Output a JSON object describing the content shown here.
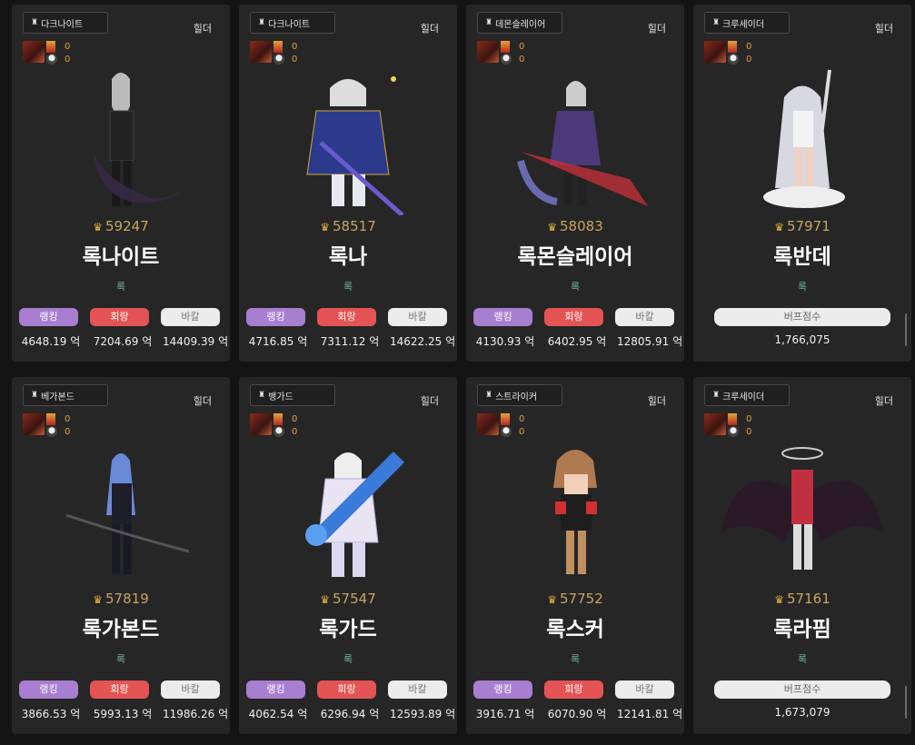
{
  "cards": [
    {
      "class": "다크나이트",
      "server": "힐더",
      "count1": "0",
      "count2": "0",
      "score": "59247",
      "name": "록나이트",
      "guild": "록",
      "type": "dealer",
      "rank_label": "랭킹",
      "corr_label": "회랑",
      "bakal_label": "바칼",
      "rank": "4648.19 억",
      "corr": "7204.69 억",
      "bakal": "14409.39 억"
    },
    {
      "class": "다크나이트",
      "server": "힐더",
      "count1": "0",
      "count2": "0",
      "score": "58517",
      "name": "록나",
      "guild": "록",
      "type": "dealer",
      "rank_label": "랭킹",
      "corr_label": "회랑",
      "bakal_label": "바칼",
      "rank": "4716.85 억",
      "corr": "7311.12 억",
      "bakal": "14622.25 억"
    },
    {
      "class": "데몬슬레이어",
      "server": "힐더",
      "count1": "0",
      "count2": "0",
      "score": "58083",
      "name": "록몬슬레이어",
      "guild": "록",
      "type": "dealer",
      "rank_label": "랭킹",
      "corr_label": "회랑",
      "bakal_label": "바칼",
      "rank": "4130.93 억",
      "corr": "6402.95 억",
      "bakal": "12805.91 억"
    },
    {
      "class": "크루세이더",
      "server": "힐더",
      "count1": "0",
      "count2": "0",
      "score": "57971",
      "name": "록반데",
      "guild": "록",
      "type": "buffer",
      "buff_label": "버프점수",
      "buff": "1,766,075"
    },
    {
      "class": "베가본드",
      "server": "힐더",
      "count1": "0",
      "count2": "0",
      "score": "57819",
      "name": "록가본드",
      "guild": "록",
      "type": "dealer",
      "rank_label": "랭킹",
      "corr_label": "회랑",
      "bakal_label": "바칼",
      "rank": "3866.53 억",
      "corr": "5993.13 억",
      "bakal": "11986.26 억"
    },
    {
      "class": "뱅가드",
      "server": "힐더",
      "count1": "0",
      "count2": "0",
      "score": "57547",
      "name": "록가드",
      "guild": "록",
      "type": "dealer",
      "rank_label": "랭킹",
      "corr_label": "회랑",
      "bakal_label": "바칼",
      "rank": "4062.54 억",
      "corr": "6296.94 억",
      "bakal": "12593.89 억"
    },
    {
      "class": "스트라이커",
      "server": "힐더",
      "count1": "0",
      "count2": "0",
      "score": "57752",
      "name": "록스커",
      "guild": "록",
      "type": "dealer",
      "rank_label": "랭킹",
      "corr_label": "회랑",
      "bakal_label": "바칼",
      "rank": "3916.71 억",
      "corr": "6070.90 억",
      "bakal": "12141.81 억"
    },
    {
      "class": "크루세이더",
      "server": "힐더",
      "count1": "0",
      "count2": "0",
      "score": "57161",
      "name": "록라핌",
      "guild": "록",
      "type": "buffer",
      "buff_label": "버프점수",
      "buff": "1,673,079"
    }
  ],
  "icons": {
    "server_icon": "server-icon",
    "score_icon": "crown-icon"
  },
  "colors": {
    "rank": "#a87ed0",
    "corridor": "#e45454",
    "bakal": "#ececec",
    "score": "#c9a460",
    "guild": "#6fb08f"
  }
}
